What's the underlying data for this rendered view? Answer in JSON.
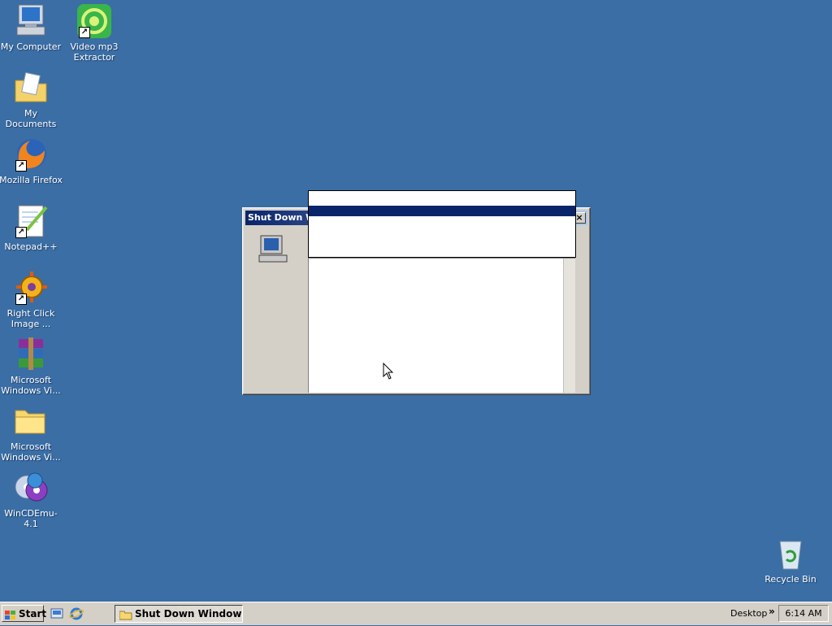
{
  "desktop": {
    "background_color": "#3a6ea5",
    "icons": [
      {
        "label": "My Computer",
        "icon": "my-computer-icon"
      },
      {
        "label": "Video mp3\nExtractor",
        "icon": "video-mp3-extractor-icon"
      },
      {
        "label": "My Documents",
        "icon": "my-documents-icon"
      },
      {
        "label": "Mozilla Firefox",
        "icon": "firefox-icon"
      },
      {
        "label": "Notepad++",
        "icon": "notepad-plus-plus-icon"
      },
      {
        "label": "Right Click\nImage ...",
        "icon": "right-click-image-icon"
      },
      {
        "label": "Microsoft\nWindows Vi...",
        "icon": "winrar-archive-icon"
      },
      {
        "label": "Microsoft\nWindows Vi...",
        "icon": "folder-icon"
      },
      {
        "label": "WinCDEmu-4.1",
        "icon": "wincdemu-icon"
      },
      {
        "label": "Recycle Bin",
        "icon": "recycle-bin-icon"
      }
    ]
  },
  "dialog": {
    "title": "Shut Down Wi",
    "close_label": "×",
    "icon": "computer-icon"
  },
  "taskbar": {
    "start_label": "Start",
    "quick_launch": [
      "show-desktop-icon",
      "internet-explorer-icon"
    ],
    "task_item_label": "Shut Down Windows",
    "toolbar_label": "Desktop",
    "chevron": "»",
    "clock": "6:14 AM"
  },
  "colors": {
    "titlebar": "#0a246a",
    "face": "#d4d0c8"
  }
}
